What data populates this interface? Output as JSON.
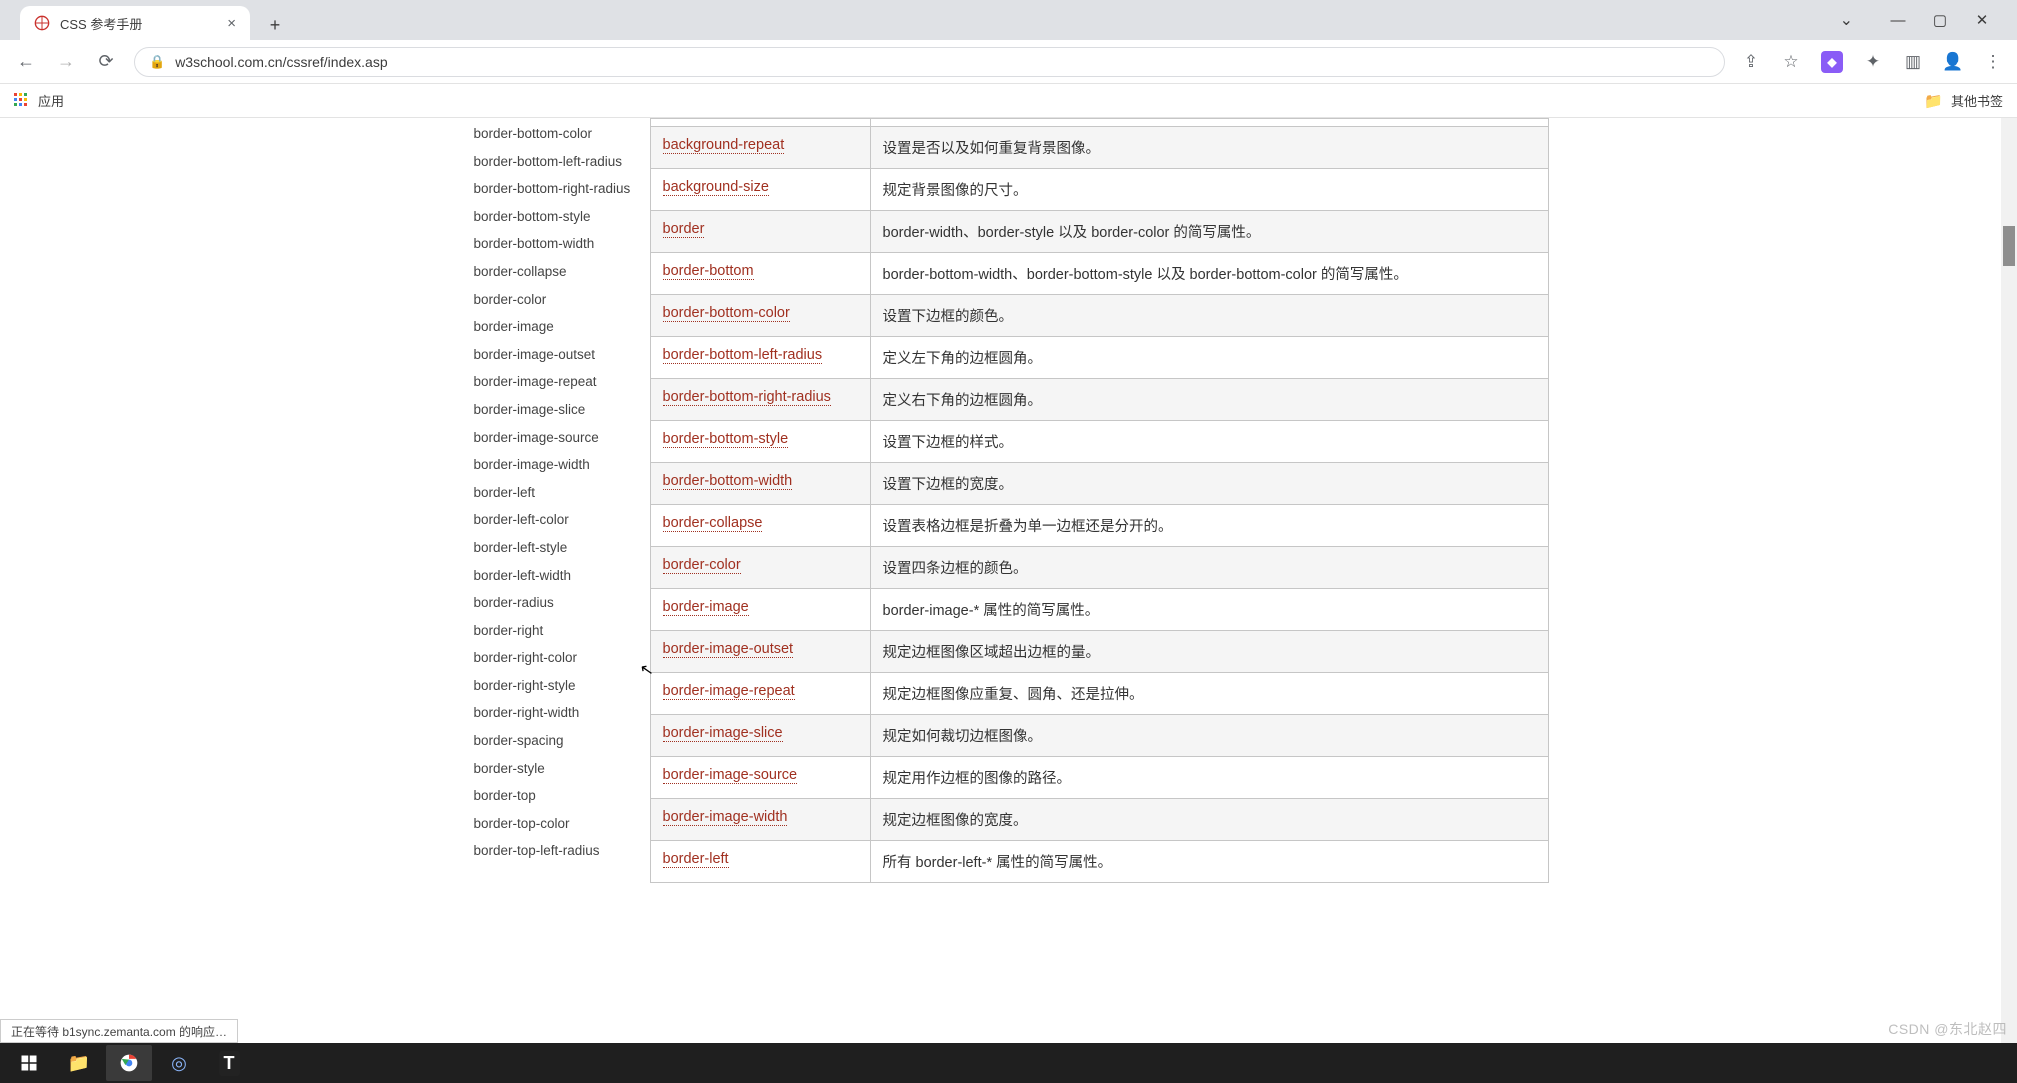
{
  "browser": {
    "tab_title": "CSS 参考手册",
    "url": "w3school.com.cn/cssref/index.asp",
    "apps_label": "应用",
    "other_bookmarks": "其他书签"
  },
  "status_bar": "正在等待 b1sync.zemanta.com 的响应…",
  "watermark": "CSDN @东北赵四",
  "sidebar": [
    "border-bottom-color",
    "border-bottom-left-radius",
    "border-bottom-right-radius",
    "border-bottom-style",
    "border-bottom-width",
    "border-collapse",
    "border-color",
    "border-image",
    "border-image-outset",
    "border-image-repeat",
    "border-image-slice",
    "border-image-source",
    "border-image-width",
    "border-left",
    "border-left-color",
    "border-left-style",
    "border-left-width",
    "border-radius",
    "border-right",
    "border-right-color",
    "border-right-style",
    "border-right-width",
    "border-spacing",
    "border-style",
    "border-top",
    "border-top-color",
    "border-top-left-radius"
  ],
  "table": [
    {
      "prop": "background-repeat",
      "desc": "设置是否以及如何重复背景图像。"
    },
    {
      "prop": "background-size",
      "desc": "规定背景图像的尺寸。"
    },
    {
      "prop": "border",
      "desc": "border-width、border-style 以及 border-color 的简写属性。"
    },
    {
      "prop": "border-bottom",
      "desc": "border-bottom-width、border-bottom-style 以及 border-bottom-color 的简写属性。"
    },
    {
      "prop": "border-bottom-color",
      "desc": "设置下边框的颜色。"
    },
    {
      "prop": "border-bottom-left-radius",
      "desc": "定义左下角的边框圆角。"
    },
    {
      "prop": "border-bottom-right-radius",
      "desc": "定义右下角的边框圆角。"
    },
    {
      "prop": "border-bottom-style",
      "desc": "设置下边框的样式。"
    },
    {
      "prop": "border-bottom-width",
      "desc": "设置下边框的宽度。"
    },
    {
      "prop": "border-collapse",
      "desc": "设置表格边框是折叠为单一边框还是分开的。"
    },
    {
      "prop": "border-color",
      "desc": "设置四条边框的颜色。"
    },
    {
      "prop": "border-image",
      "desc": "border-image-* 属性的简写属性。"
    },
    {
      "prop": "border-image-outset",
      "desc": "规定边框图像区域超出边框的量。"
    },
    {
      "prop": "border-image-repeat",
      "desc": "规定边框图像应重复、圆角、还是拉伸。"
    },
    {
      "prop": "border-image-slice",
      "desc": "规定如何裁切边框图像。"
    },
    {
      "prop": "border-image-source",
      "desc": "规定用作边框的图像的路径。"
    },
    {
      "prop": "border-image-width",
      "desc": "规定边框图像的宽度。"
    },
    {
      "prop": "border-left",
      "desc": "所有 border-left-* 属性的简写属性。"
    }
  ]
}
